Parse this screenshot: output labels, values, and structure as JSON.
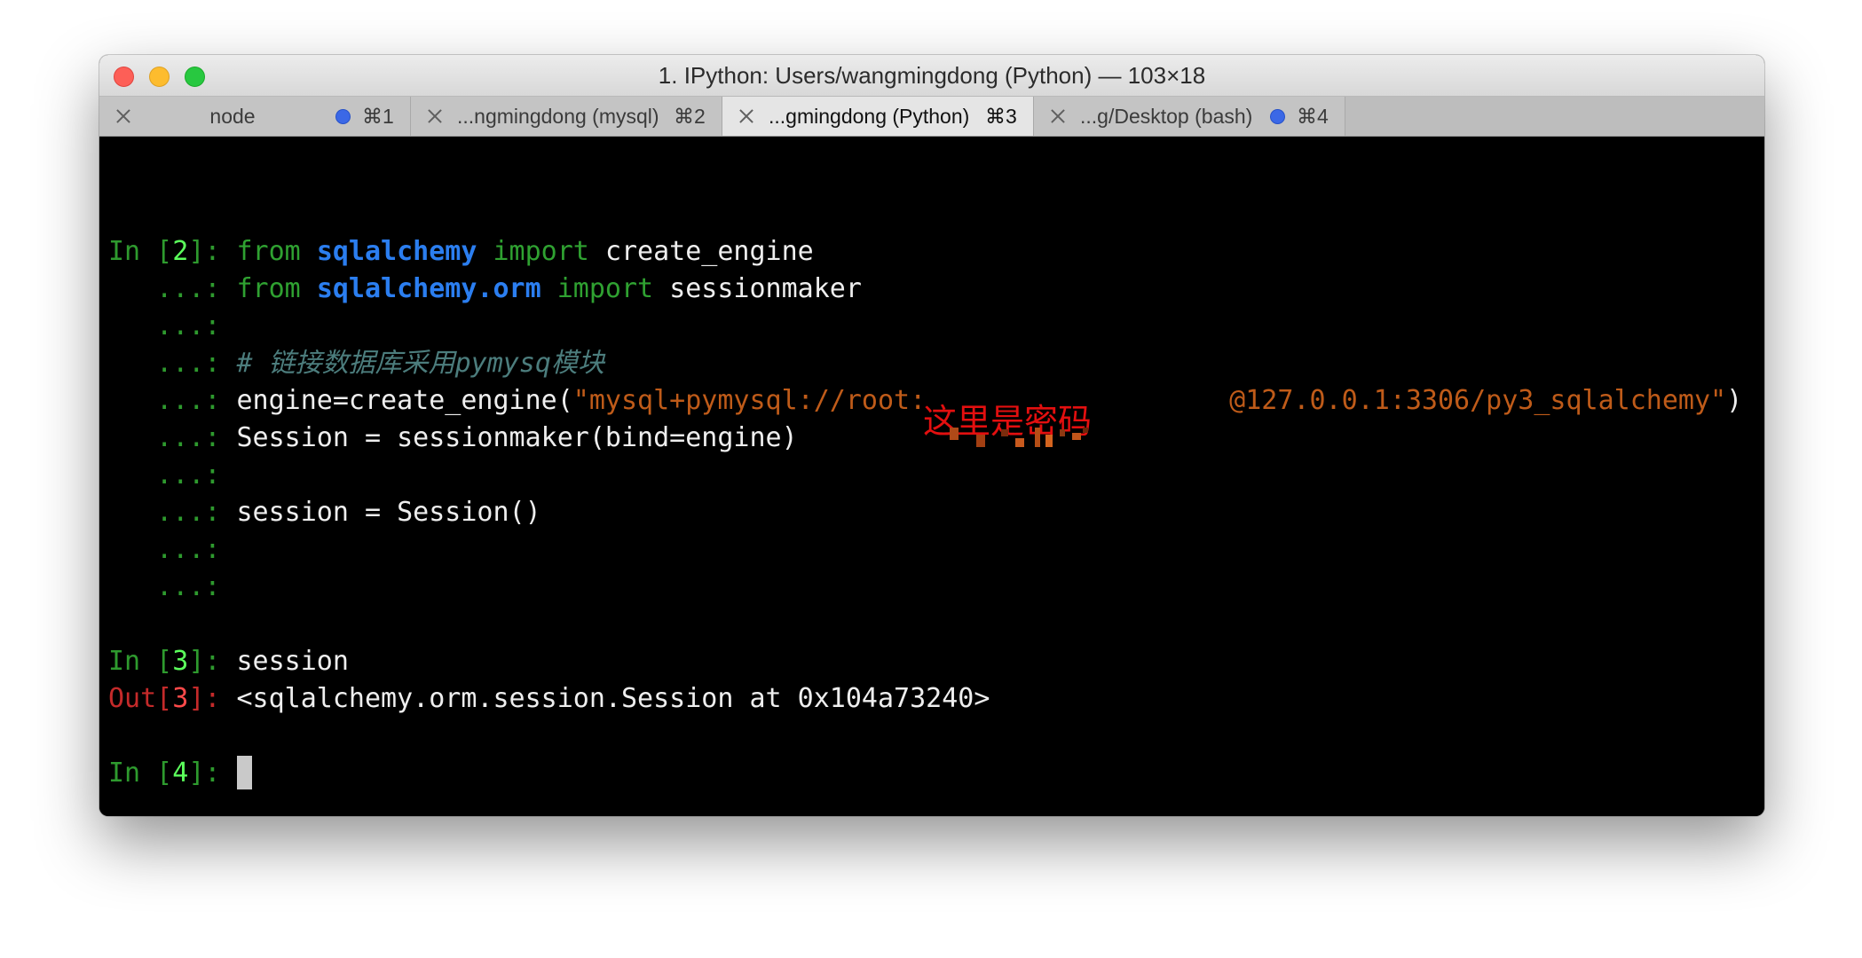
{
  "window": {
    "title": "1. IPython: Users/wangmingdong (Python) — 103×18"
  },
  "tabs": [
    {
      "label": "node",
      "shortcut": "⌘1",
      "active": false,
      "activity_dot": true
    },
    {
      "label": "...ngmingdong (mysql)",
      "shortcut": "⌘2",
      "active": false,
      "activity_dot": false
    },
    {
      "label": "...gmingdong (Python)",
      "shortcut": "⌘3",
      "active": true,
      "activity_dot": false
    },
    {
      "label": "...g/Desktop (bash)",
      "shortcut": "⌘4",
      "active": false,
      "activity_dot": true
    }
  ],
  "colors": {
    "prompt_green": "#2e9a2e",
    "prompt_number": "#5cff5c",
    "out_red": "#c42a2a",
    "module_blue": "#2b7ef0",
    "string_orange": "#bf5b19",
    "comment": "#4c7d7d",
    "annotation_red": "#e30f0f",
    "tab_dot_blue": "#3b68e6"
  },
  "terminal": {
    "prompt_in_open": "In [",
    "prompt_close": "]: ",
    "prompt_out_open": "Out[",
    "continuation": "   ...: ",
    "cell2": {
      "number": "2",
      "l1_from": "from",
      "l1_module": "sqlalchemy",
      "l1_import": "import",
      "l1_name": "create_engine",
      "l2_from": "from",
      "l2_module": "sqlalchemy.orm",
      "l2_import": "import",
      "l2_name": "sessionmaker",
      "comment": "# 链接数据库采用pymysq模块",
      "engine_call": "engine=create_engine(",
      "url_start": "\"mysql+pymysql://root:",
      "url_end": "@127.0.0.1:3306/py3_sqlalchemy\"",
      "engine_close": ")",
      "session_maker": "Session = sessionmaker(bind=engine)",
      "session_create": "session = Session()"
    },
    "cell3": {
      "number": "3",
      "input": "session",
      "output": "<sqlalchemy.orm.session.Session at 0x104a73240>"
    },
    "cell4": {
      "number": "4"
    }
  },
  "annotation": {
    "text": "这里是密码"
  }
}
